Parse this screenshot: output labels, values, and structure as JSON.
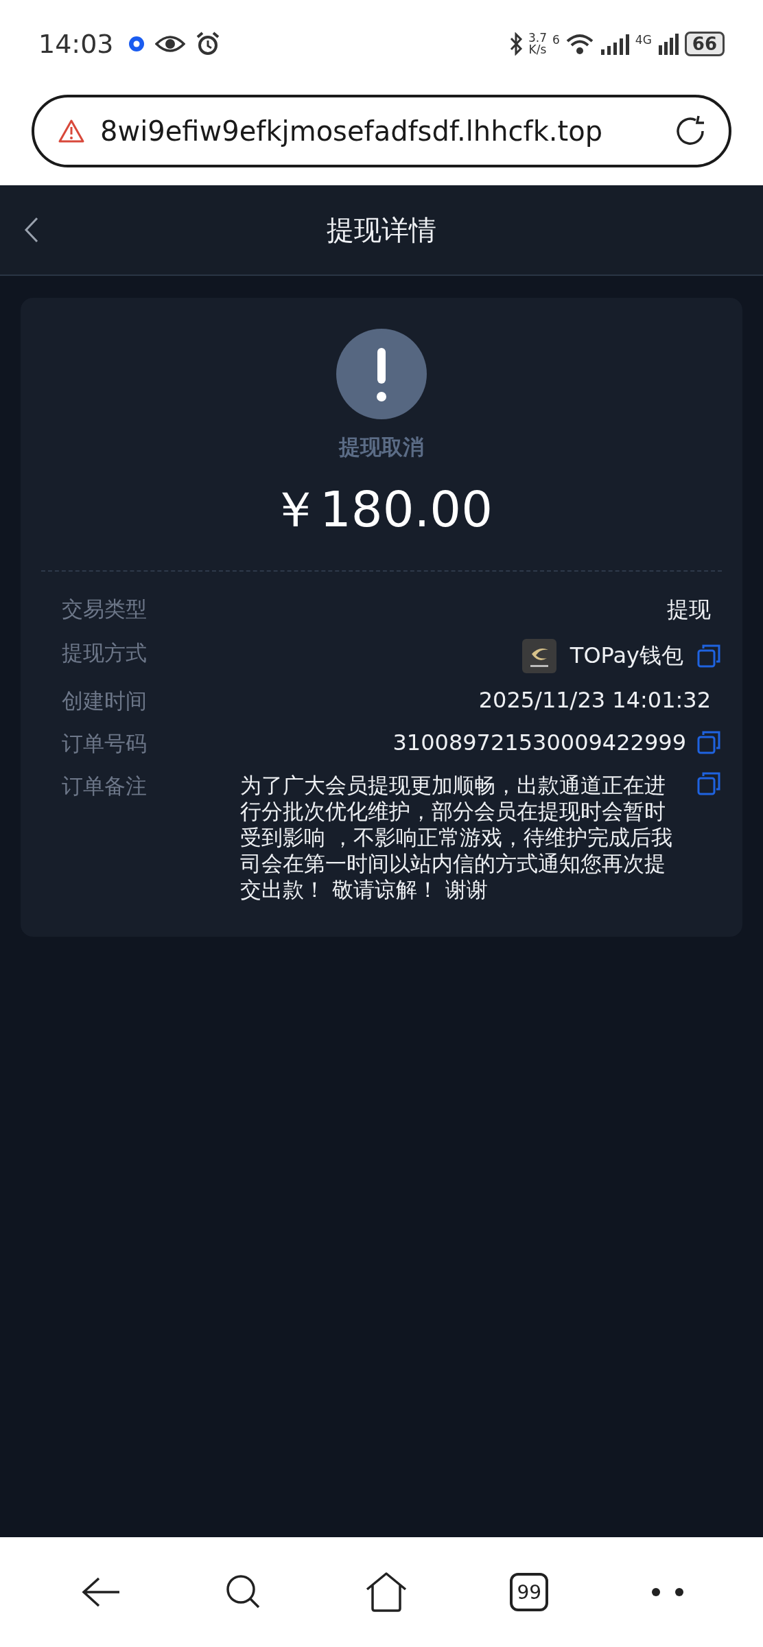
{
  "status_bar": {
    "time": "14:03",
    "speed_value": "3.7",
    "speed_unit": "K/s",
    "wifi_label": "6",
    "network_label": "4G",
    "battery": "66"
  },
  "address_bar": {
    "url": "8wi9efiw9efkjmosefadfsdf.lhhcfk.top"
  },
  "header": {
    "title": "提现详情"
  },
  "summary": {
    "status": "提现取消",
    "amount": "￥180.00"
  },
  "details": [
    {
      "kind": "text",
      "label": "交易类型",
      "value": "提现",
      "copyable": false
    },
    {
      "kind": "wallet",
      "label": "提现方式",
      "value": "TOPay钱包",
      "copyable": true
    },
    {
      "kind": "text",
      "label": "创建时间",
      "value": "2025/11/23 14:01:32",
      "copyable": false
    },
    {
      "kind": "text",
      "label": "订单号码",
      "value": "310089721530009422999",
      "copyable": true
    },
    {
      "kind": "note",
      "label": "订单备注",
      "value": "为了广大会员提现更加顺畅，出款通道正在进行分批次优化维护，部分会员在提现时会暂时受到影响 ，不影响正常游戏，待维护完成后我司会在第一时间以站内信的方式通知您再次提交出款！ 敬请谅解！ 谢谢",
      "copyable": true
    }
  ],
  "bottom_nav": {
    "tabs_count": "99"
  }
}
